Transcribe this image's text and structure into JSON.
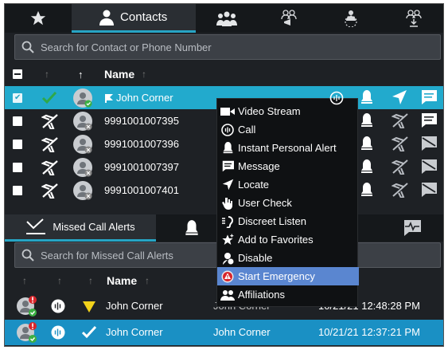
{
  "top_tabs": {
    "contacts_label": "Contacts",
    "icons": [
      "star-icon",
      "contact-person-icon",
      "group-icon",
      "broadcast-group-icon",
      "dynamic-group-icon",
      "group-download-icon"
    ]
  },
  "search": {
    "placeholder": "Search for Contact or Phone Number"
  },
  "contacts_header": {
    "name": "Name"
  },
  "contacts": [
    {
      "name": "John Corner",
      "selected": true
    },
    {
      "name": "9991001007395",
      "selected": false
    },
    {
      "name": "9991001007396",
      "selected": false
    },
    {
      "name": "9991001007397",
      "selected": false
    },
    {
      "name": "9991001007401",
      "selected": false
    }
  ],
  "lower_tabs": {
    "missed_calls_label": "Missed Call Alerts"
  },
  "missed_search": {
    "placeholder": "Search for Missed Call Alerts"
  },
  "missed_header": {
    "name": "Name"
  },
  "missed_calls": [
    {
      "name": "John Corner",
      "contact": "John Corner",
      "time": "10/21/21 12:48:28 PM"
    },
    {
      "name": "John Corner",
      "contact": "John Corner",
      "time": "10/21/21 12:37:21 PM"
    }
  ],
  "context_menu": {
    "items": [
      "Video Stream",
      "Call",
      "Instant Personal Alert",
      "Message",
      "Locate",
      "User Check",
      "Discreet Listen",
      "Add to Favorites",
      "Disable",
      "Start Emergency",
      "Affiliations"
    ],
    "highlighted": "Start Emergency"
  },
  "colors": {
    "accent": "#27a4c4",
    "selected_row": "#22aacd",
    "menu_highlight": "#5a86d0",
    "status_green": "#3cb043",
    "warning_yellow": "#f2d21b"
  }
}
